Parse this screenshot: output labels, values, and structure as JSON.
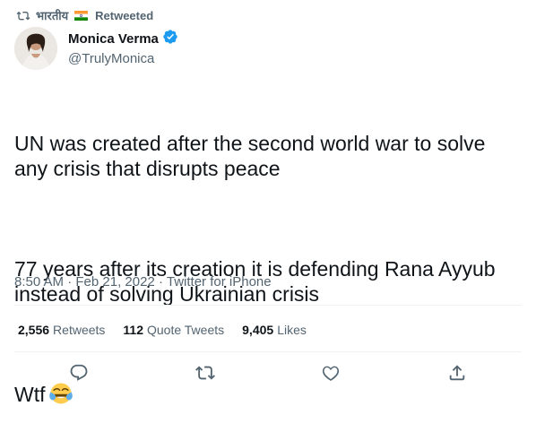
{
  "social_context": {
    "label_prefix": "भारतीय",
    "label_suffix": "Retweeted",
    "icon": "retweet-icon",
    "flag": "india-flag"
  },
  "author": {
    "display_name": "Monica Verma",
    "handle": "@TrulyMonica",
    "verified": true,
    "avatar": "profile-photo"
  },
  "tweet": {
    "paragraphs": [
      "UN was created after the second world war to solve any crisis that disrupts peace",
      "77 years after its creation it is defending Rana Ayyub instead of solving Ukrainian crisis",
      "Wtf"
    ],
    "emoji": "face-with-tears-of-joy"
  },
  "meta": {
    "time": "8:50 AM",
    "date": "Feb 21, 2022",
    "source": "Twitter for iPhone"
  },
  "stats": {
    "retweets": {
      "count": "2,556",
      "label": "Retweets"
    },
    "quote_tweets": {
      "count": "112",
      "label": "Quote Tweets"
    },
    "likes": {
      "count": "9,405",
      "label": "Likes"
    }
  },
  "actions": [
    "reply-icon",
    "retweet-icon",
    "like-icon",
    "share-icon"
  ],
  "colors": {
    "text": "#0f1419",
    "secondary": "#536471",
    "verified": "#1d9bf0",
    "divider": "#eff3f4"
  }
}
